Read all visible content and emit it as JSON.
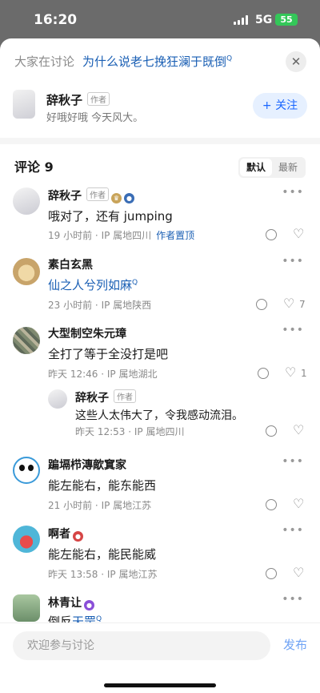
{
  "status": {
    "time": "16:20",
    "network": "5G",
    "battery": "55"
  },
  "topic": {
    "prefix": "大家在讨论",
    "title": "为什么说老七挽狂澜于既倒",
    "search_mark": "Q",
    "close": "✕"
  },
  "author": {
    "name": "辞秋子",
    "tag": "作者",
    "bio": "好哦好哦 今天风大。",
    "follow_label": "+ 关注"
  },
  "comments_header": {
    "title": "评论 9",
    "sort_default": "默认",
    "sort_latest": "最新"
  },
  "comments": [
    {
      "name": "辞秋子",
      "tag": "作者",
      "text": "哦对了，还有 jumping",
      "time": "19 小时前",
      "location": "IP 属地四川",
      "pinned": "作者置顶",
      "likes": ""
    },
    {
      "name": "素白玄黑",
      "text": "仙之人兮列如麻",
      "search_mark": "Q",
      "time": "23 小时前",
      "location": "IP 属地陕西",
      "likes": "7"
    },
    {
      "name": "大型制空朱元璋",
      "text": "全打了等于全没打是吧",
      "time": "昨天 12:46",
      "location": "IP 属地湖北",
      "likes": "1"
    },
    {
      "name": "辞秋子",
      "tag": "作者",
      "text": "这些人太伟大了，令我感动流泪。",
      "time": "昨天 12:53",
      "location": "IP 属地四川",
      "likes": ""
    },
    {
      "name": "蹁塥栉漙歒窴家",
      "text": "能左能右，能东能西",
      "time": "21 小时前",
      "location": "IP 属地江苏",
      "likes": ""
    },
    {
      "name": "啊者",
      "text": "能左能右，能民能威",
      "time": "昨天 13:58",
      "location": "IP 属地江苏",
      "likes": ""
    },
    {
      "name": "林青让",
      "text_plain": "倒反",
      "text_link": "天罡",
      "search_mark": "Q"
    }
  ],
  "separator": "·",
  "bottom": {
    "input_placeholder": "欢迎参与讨论",
    "publish_label": "发布"
  },
  "colors": {
    "link": "#1a5fb4",
    "accent": "#1a66ff",
    "battery": "#34c759"
  }
}
